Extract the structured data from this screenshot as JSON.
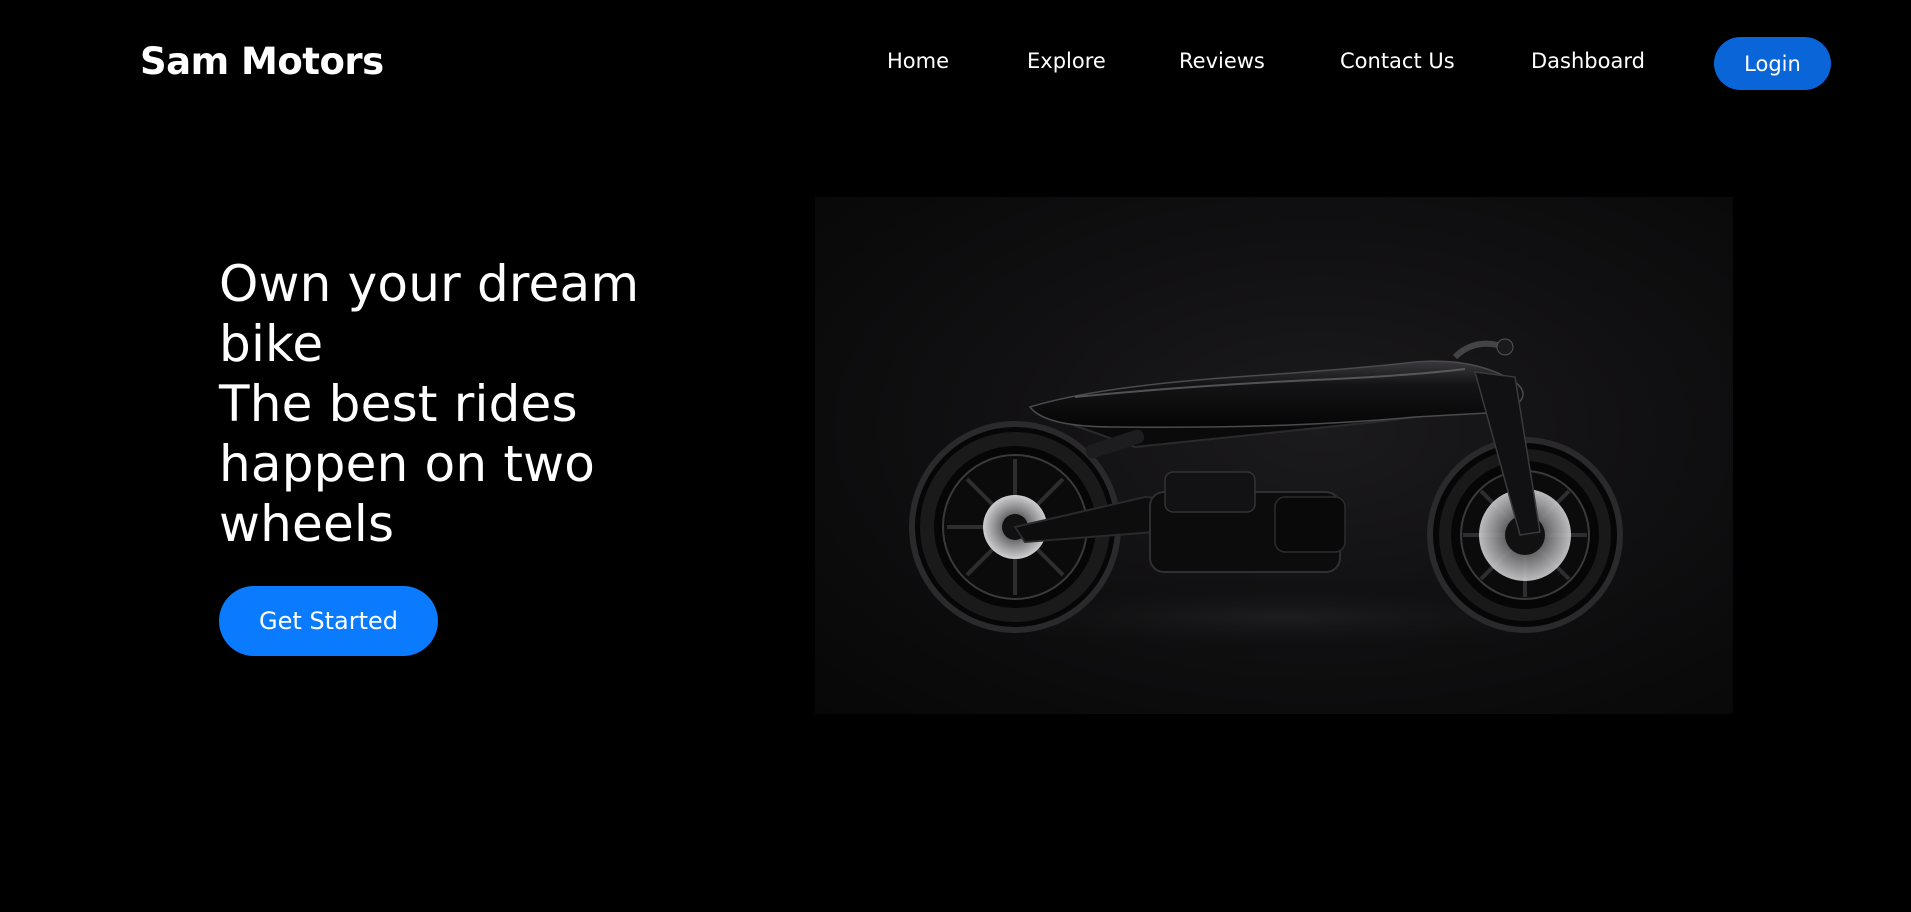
{
  "brand": {
    "name": "Sam Motors"
  },
  "nav": {
    "items": [
      {
        "label": "Home"
      },
      {
        "label": "Explore"
      },
      {
        "label": "Reviews"
      },
      {
        "label": "Contact Us"
      },
      {
        "label": "Dashboard"
      }
    ],
    "login_label": "Login"
  },
  "hero": {
    "title_line1": "Own your dream",
    "title_line2": "bike",
    "title_line3": "The best rides",
    "title_line4": "happen on two",
    "title_line5": "wheels",
    "cta_label": "Get Started",
    "image_subject": "black cafe-racer motorcycle on dark background"
  },
  "colors": {
    "background": "#000000",
    "text": "#ffffff",
    "login_button": "#0a66d8",
    "cta_button": "#0a7bff"
  }
}
